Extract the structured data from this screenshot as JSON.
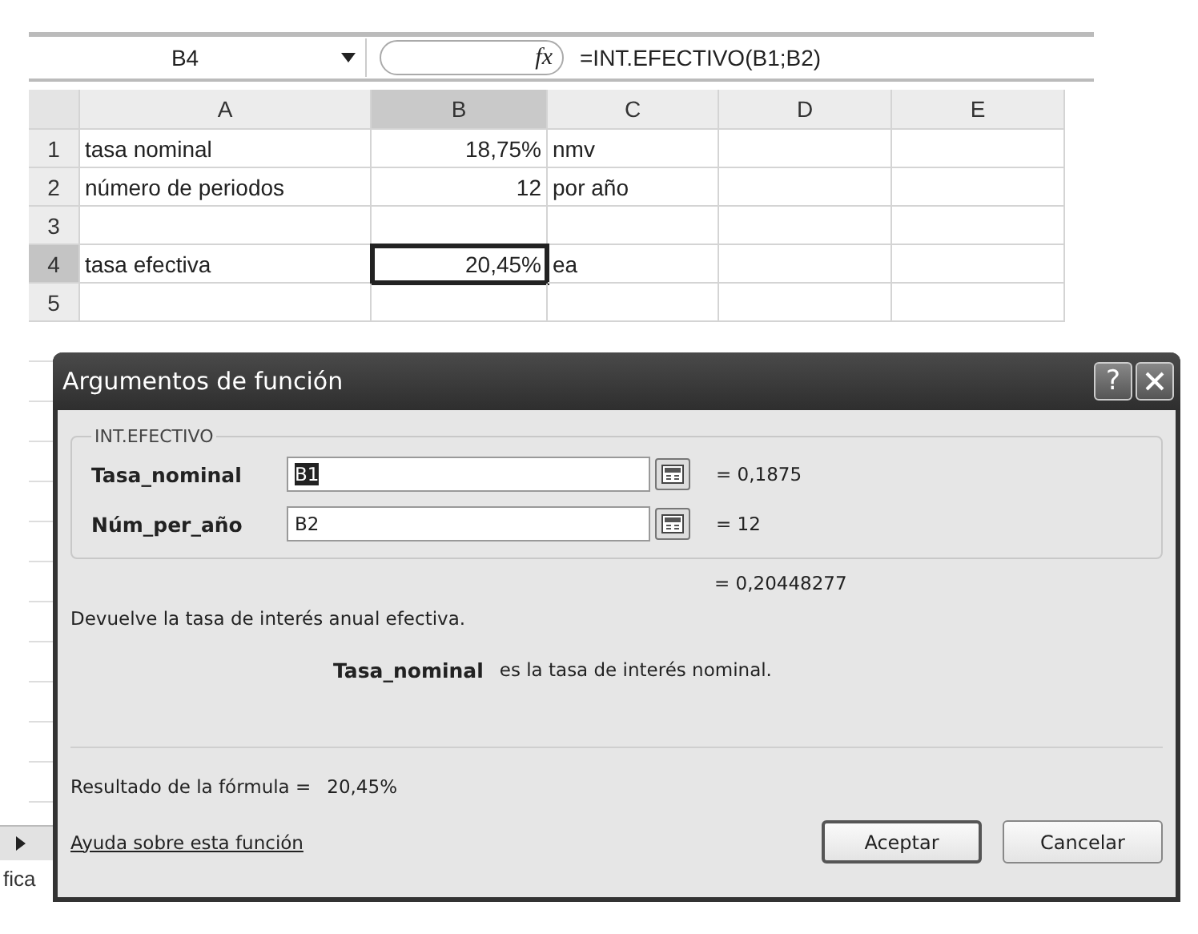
{
  "formula_bar": {
    "name_box": "B4",
    "fx_label": "fx",
    "formula": "=INT.EFECTIVO(B1;B2)"
  },
  "sheet": {
    "columns": [
      {
        "label": "A",
        "selected": false
      },
      {
        "label": "B",
        "selected": true
      },
      {
        "label": "C",
        "selected": false
      },
      {
        "label": "D",
        "selected": false
      },
      {
        "label": "E",
        "selected": false
      }
    ],
    "rows": [
      {
        "header": "1",
        "selected": false,
        "cells": [
          {
            "text": "tasa nominal",
            "selected": false
          },
          {
            "text": "18,75%",
            "selected": false
          },
          {
            "text": "nmv",
            "selected": false
          }
        ]
      },
      {
        "header": "2",
        "selected": false,
        "cells": [
          {
            "text": "número de periodos",
            "selected": false
          },
          {
            "text": "12",
            "selected": false
          },
          {
            "text": "por año",
            "selected": false
          }
        ]
      },
      {
        "header": "3",
        "selected": false
      },
      {
        "header": "4",
        "selected": true,
        "cells": [
          {
            "text": "tasa efectiva",
            "selected": false
          },
          {
            "text": "20,45%",
            "selected": true
          },
          {
            "text": "ea",
            "selected": false
          }
        ]
      },
      {
        "header": "5",
        "selected": false
      }
    ]
  },
  "dialog": {
    "title": "Argumentos de función",
    "help_button": "?",
    "group_label": "INT.EFECTIVO",
    "arguments": [
      {
        "label": "Tasa_nominal",
        "value": "B1",
        "focused": true,
        "result": "= 0,1875"
      },
      {
        "label": "Núm_per_año",
        "value": "B2",
        "focused": false,
        "result": "= 12"
      }
    ],
    "total_result": "= 0,20448277",
    "description": "Devuelve la tasa de interés anual efectiva.",
    "argument_help": {
      "name": "Tasa_nominal",
      "text": "es la tasa de interés nominal."
    },
    "formula_result": {
      "label": "Resultado de la fórmula =",
      "value": "20,45%"
    },
    "help_link": "Ayuda sobre esta función",
    "buttons": [
      {
        "label": "Aceptar",
        "default": true
      },
      {
        "label": "Cancelar",
        "default": false
      }
    ]
  },
  "sheet_tab_fragment": "fica"
}
